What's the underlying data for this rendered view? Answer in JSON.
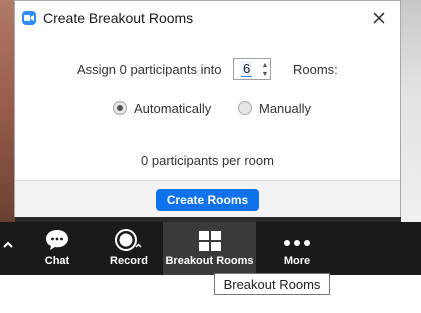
{
  "dialog": {
    "title": "Create Breakout Rooms",
    "assign_prefix": "Assign 0 participants into",
    "room_count": "6",
    "rooms_suffix": "Rooms:",
    "options": [
      {
        "label": "Automatically",
        "selected": true
      },
      {
        "label": "Manually",
        "selected": false
      }
    ],
    "per_room_text": "0 participants per room",
    "create_label": "Create Rooms"
  },
  "toolbar": {
    "items": [
      {
        "label": "Chat",
        "icon": "chat-bubble-icon"
      },
      {
        "label": "Record",
        "icon": "record-icon"
      },
      {
        "label": "Breakout Rooms",
        "icon": "breakout-rooms-icon",
        "active": true
      },
      {
        "label": "More",
        "icon": "more-dots-icon"
      }
    ]
  },
  "tooltip": {
    "text": "Breakout Rooms"
  },
  "colors": {
    "accent": "#0e72ed",
    "app_icon": "#2d8cff",
    "toolbar_bg": "#1a1a1a"
  }
}
